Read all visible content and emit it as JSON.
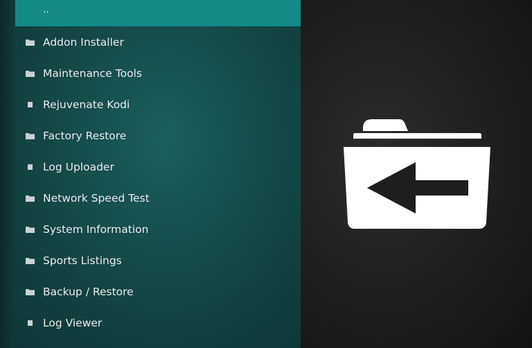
{
  "menu": {
    "parent": {
      "label": "..",
      "icon": "parent-directory"
    },
    "items": [
      {
        "label": "Addon Installer",
        "icon": "folder-icon"
      },
      {
        "label": "Maintenance Tools",
        "icon": "folder-icon"
      },
      {
        "label": "Rejuvenate Kodi",
        "icon": "file-icon"
      },
      {
        "label": "Factory Restore",
        "icon": "folder-icon"
      },
      {
        "label": "Log Uploader",
        "icon": "file-icon"
      },
      {
        "label": "Network Speed Test",
        "icon": "folder-icon"
      },
      {
        "label": "System Information",
        "icon": "folder-icon"
      },
      {
        "label": "Sports Listings",
        "icon": "folder-icon"
      },
      {
        "label": "Backup / Restore",
        "icon": "folder-icon"
      },
      {
        "label": "Log Viewer",
        "icon": "file-icon"
      }
    ]
  },
  "preview": {
    "icon": "folder-back-icon"
  },
  "colors": {
    "highlight": "#138a86",
    "panel": "#144a48",
    "background": "#1e1e1e",
    "text": "#e9ecec"
  }
}
